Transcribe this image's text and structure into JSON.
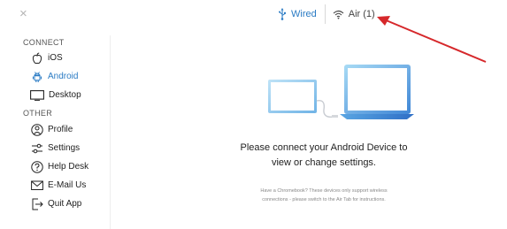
{
  "window": {
    "close_label": "×"
  },
  "tabs": [
    {
      "label": "Wired",
      "icon": "usb-icon",
      "active": true
    },
    {
      "label": "Air (1)",
      "icon": "wifi-icon",
      "active": false
    }
  ],
  "sidebar": {
    "connect_title": "CONNECT",
    "connect_items": [
      {
        "label": "iOS",
        "icon": "apple-icon",
        "active": false
      },
      {
        "label": "Android",
        "icon": "android-icon",
        "active": true
      },
      {
        "label": "Desktop",
        "icon": "monitor-icon",
        "active": false
      }
    ],
    "other_title": "OTHER",
    "other_items": [
      {
        "label": "Profile",
        "icon": "profile-icon"
      },
      {
        "label": "Settings",
        "icon": "settings-icon"
      },
      {
        "label": "Help Desk",
        "icon": "help-icon"
      },
      {
        "label": "E-Mail Us",
        "icon": "mail-icon"
      },
      {
        "label": "Quit App",
        "icon": "quit-icon"
      }
    ]
  },
  "main": {
    "message_line1": "Please connect your Android Device to",
    "message_line2": "view or change settings.",
    "note_line1": "Have a Chromebook? These devices only support wireless",
    "note_line2": "connections - please switch to the Air Tab for instructions."
  },
  "colors": {
    "accent": "#2a7bc4",
    "annotation_arrow": "#d6282b"
  }
}
